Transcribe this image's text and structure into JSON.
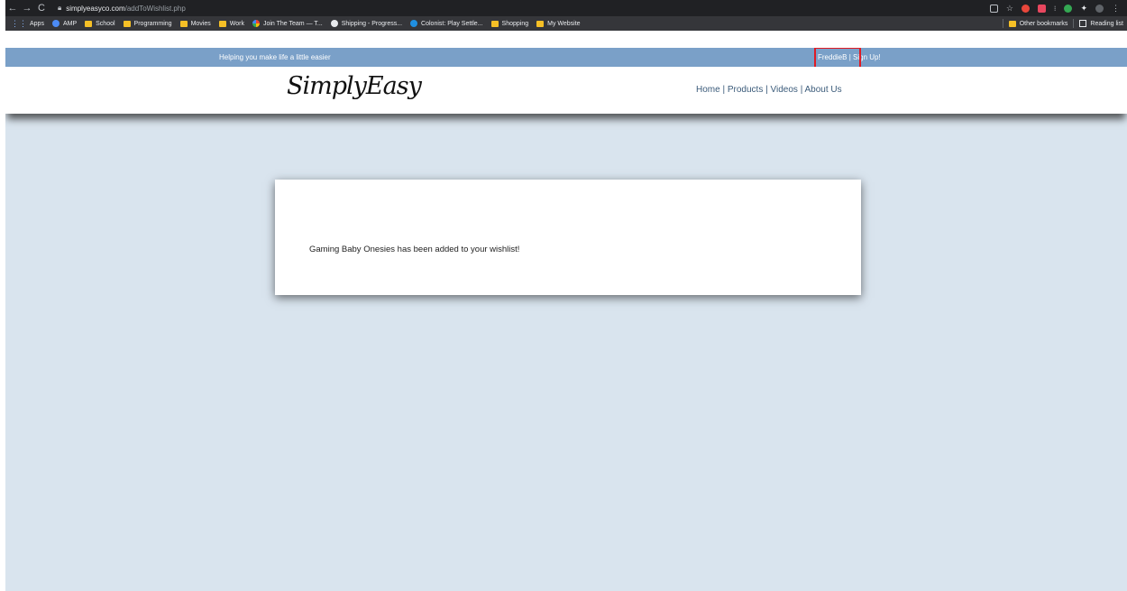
{
  "browser": {
    "url_host": "simplyeasyco.com",
    "url_path": "/addToWishlist.php",
    "bookmarks": [
      {
        "label": "Apps",
        "icon": "apps-grid-icon"
      },
      {
        "label": "AMP",
        "icon": "amp-icon"
      },
      {
        "label": "School",
        "icon": "folder-icon"
      },
      {
        "label": "Programming",
        "icon": "folder-icon"
      },
      {
        "label": "Movies",
        "icon": "folder-icon"
      },
      {
        "label": "Work",
        "icon": "folder-icon"
      },
      {
        "label": "Join The Team — T...",
        "icon": "site-icon"
      },
      {
        "label": "Shipping - Progress...",
        "icon": "site-icon"
      },
      {
        "label": "Colonist: Play Settle...",
        "icon": "site-icon"
      },
      {
        "label": "Shopping",
        "icon": "folder-icon"
      },
      {
        "label": "My Website",
        "icon": "folder-icon"
      }
    ],
    "other_bookmarks": "Other bookmarks",
    "reading_list": "Reading list"
  },
  "site": {
    "tagline": "Helping you make life a little easier",
    "account": {
      "username": "FreddieB",
      "separator": "|",
      "signup": "Sign Up!"
    },
    "logo": "SimplyEasy",
    "nav": {
      "home": "Home",
      "products": "Products",
      "videos": "Videos",
      "about": "About Us",
      "separator": "|"
    },
    "notice": "Gaming Baby Onesies has been added to your wishlist!",
    "colors": {
      "topbar": "#7aa0c8",
      "page_bg": "#d9e4ee",
      "highlight": "#e01b24"
    }
  }
}
